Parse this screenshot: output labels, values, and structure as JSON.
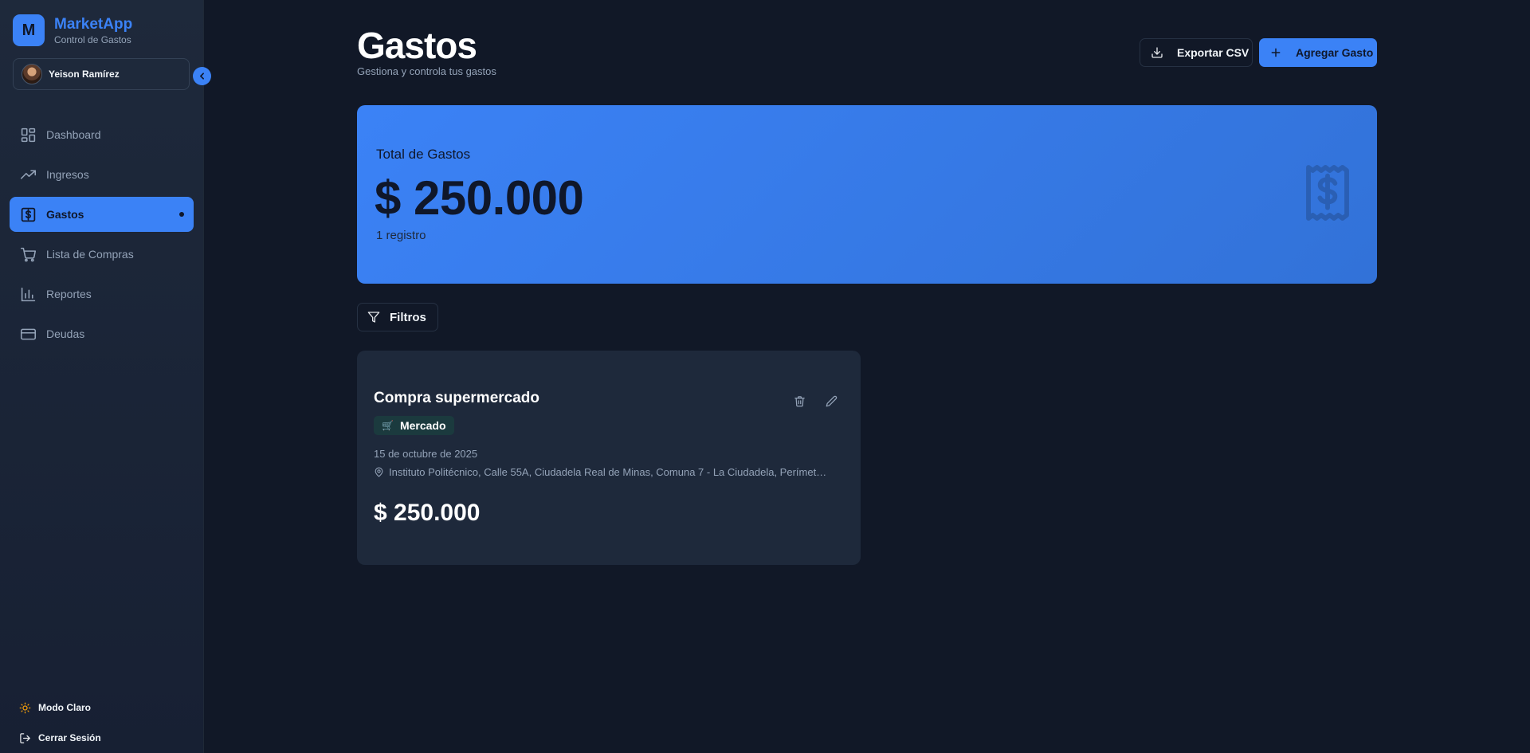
{
  "brand": {
    "logo_letter": "M",
    "name": "MarketApp",
    "subtitle": "Control de Gastos"
  },
  "user": {
    "name": "Yeison Ramírez",
    "avatar_icon": "user-avatar"
  },
  "sidebar": {
    "collapse_icon": "chevron-left-icon",
    "items": [
      {
        "label": "Dashboard",
        "icon": "dashboard-icon",
        "active": false
      },
      {
        "label": "Ingresos",
        "icon": "trending-up-icon",
        "active": false
      },
      {
        "label": "Gastos",
        "icon": "dollar-receipt-icon",
        "active": true
      },
      {
        "label": "Lista de Compras",
        "icon": "shopping-cart-icon",
        "active": false
      },
      {
        "label": "Reportes",
        "icon": "bar-chart-icon",
        "active": false
      },
      {
        "label": "Deudas",
        "icon": "credit-card-icon",
        "active": false
      }
    ],
    "theme_toggle": "Modo Claro",
    "logout": "Cerrar Sesión"
  },
  "header": {
    "title": "Gastos",
    "subtitle": "Gestiona y controla tus gastos",
    "export_label": "Exportar CSV",
    "add_label": "Agregar Gasto"
  },
  "summary": {
    "label": "Total de Gastos",
    "amount": "$ 250.000",
    "count": "1 registro"
  },
  "filters": {
    "label": "Filtros"
  },
  "expenses": [
    {
      "title": "Compra supermercado",
      "category": "Mercado",
      "category_icon": "cart-emoji-icon",
      "date": "15 de octubre de 2025",
      "location": "Instituto Politécnico, Calle 55A, Ciudadela Real de Minas, Comuna 7 - La Ciudadela, Perímet…",
      "amount": "$ 250.000"
    }
  ],
  "colors": {
    "accent": "#3b82f6",
    "background": "#111827",
    "card": "#1e293b",
    "muted_text": "#94a3b8"
  }
}
